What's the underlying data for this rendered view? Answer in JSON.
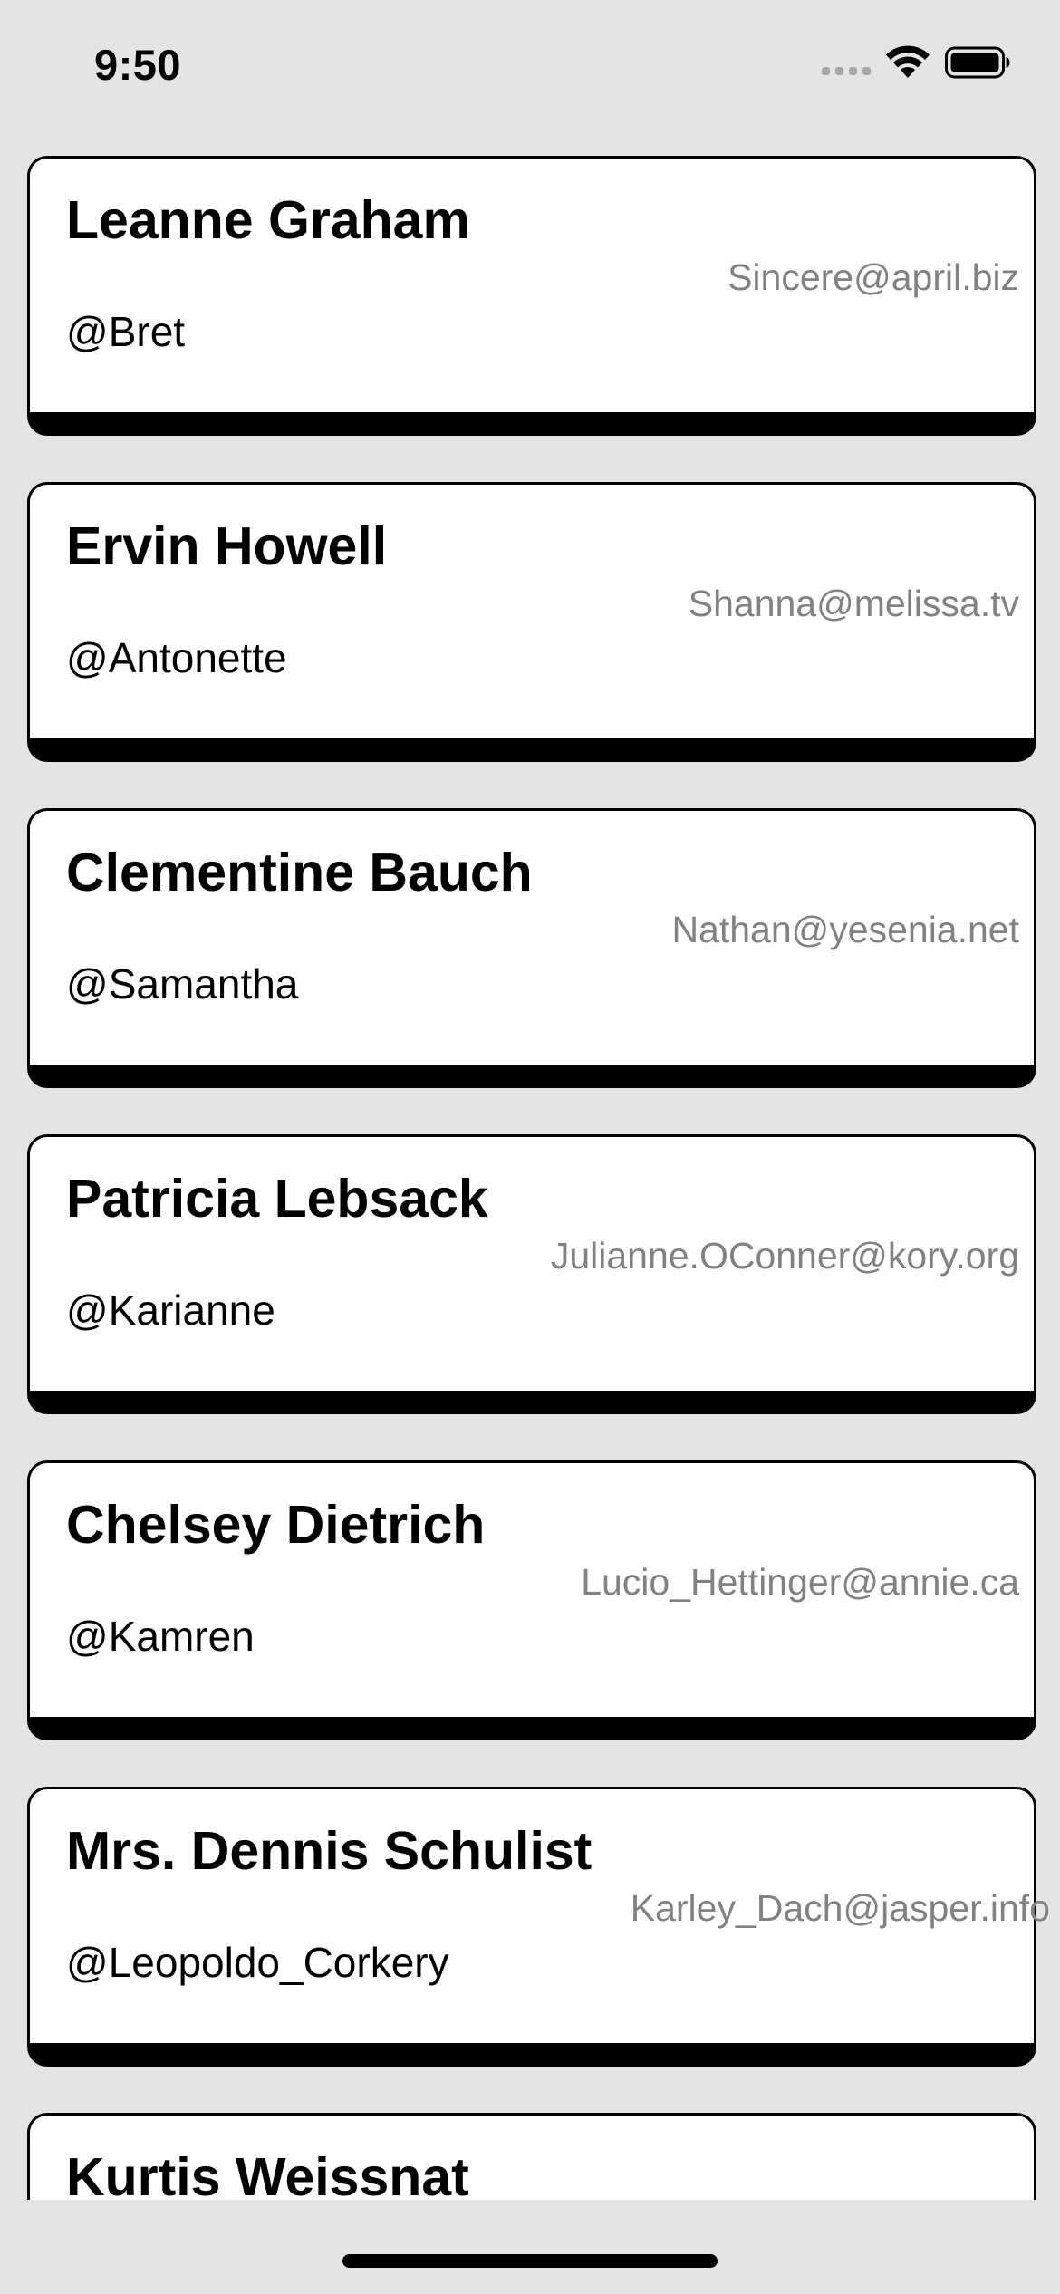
{
  "status_bar": {
    "time": "9:50"
  },
  "users": [
    {
      "name": "Leanne Graham",
      "username": "@Bret",
      "email": "Sincere@april.biz"
    },
    {
      "name": "Ervin Howell",
      "username": "@Antonette",
      "email": "Shanna@melissa.tv"
    },
    {
      "name": "Clementine Bauch",
      "username": "@Samantha",
      "email": "Nathan@yesenia.net"
    },
    {
      "name": "Patricia Lebsack",
      "username": "@Karianne",
      "email": "Julianne.OConner@kory.org"
    },
    {
      "name": "Chelsey Dietrich",
      "username": "@Kamren",
      "email": "Lucio_Hettinger@annie.ca"
    },
    {
      "name": "Mrs. Dennis Schulist",
      "username": "@Leopoldo_Corkery",
      "email": "Karley_Dach@jasper.info"
    },
    {
      "name": "Kurtis Weissnat",
      "username": "",
      "email": ""
    }
  ]
}
